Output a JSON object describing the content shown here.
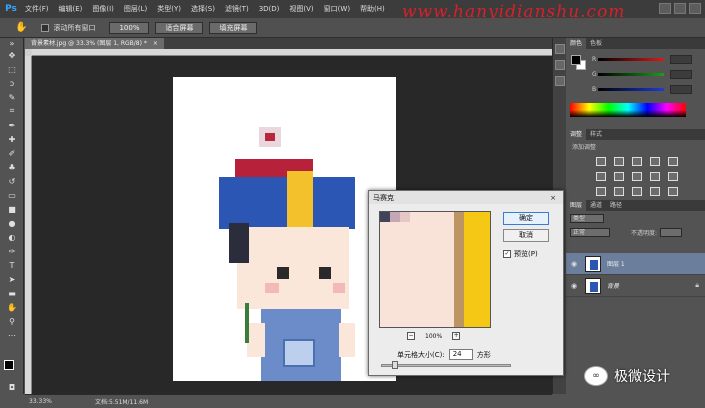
{
  "app": {
    "logo": "Ps",
    "watermark": "www.hanyidianshu.com"
  },
  "menubar": {
    "items": [
      "文件(F)",
      "编辑(E)",
      "图像(I)",
      "图层(L)",
      "类型(Y)",
      "选择(S)",
      "滤镜(T)",
      "3D(D)",
      "视图(V)",
      "窗口(W)",
      "帮助(H)"
    ]
  },
  "options": {
    "scroll_all_label": "滚动所有窗口",
    "btn_100": "100%",
    "btn_fit": "适合屏幕",
    "btn_fill": "填充屏幕"
  },
  "document": {
    "tab_title": "背景素材.jpg @ 33.3% (图层 1, RGB/8) *",
    "tab_close": "×"
  },
  "status": {
    "zoom": "33.33%",
    "docinfo": "文档:5.51M/11.6M"
  },
  "color_panel": {
    "tabs": [
      "颜色",
      "色板"
    ],
    "sliders": [
      "R",
      "G",
      "B"
    ],
    "colors": {
      "r": "#d81b1b",
      "g": "#1c9c1c",
      "b": "#1c3cd8"
    }
  },
  "adjustments": {
    "tabs": [
      "调整",
      "样式"
    ],
    "title": "添加调整"
  },
  "layers_panel": {
    "tabs": [
      "图层",
      "通道",
      "路径"
    ],
    "kind_filter": "类型",
    "blend_mode": "正常",
    "opacity_label": "不透明度:",
    "layers": [
      {
        "name": "图层 1",
        "selected": true
      },
      {
        "name": "背景",
        "selected": false,
        "locked": true
      }
    ]
  },
  "mosaic_dialog": {
    "title": "马赛克",
    "ok": "确定",
    "cancel": "取消",
    "preview_label": "预览(P)",
    "zoom_level": "100%",
    "zoom_out": "−",
    "zoom_in": "+",
    "cell_size_label": "单元格大小(C):",
    "cell_size_value": "24",
    "unit": "方形",
    "close": "×"
  },
  "wechat": {
    "text": "极微设计"
  }
}
